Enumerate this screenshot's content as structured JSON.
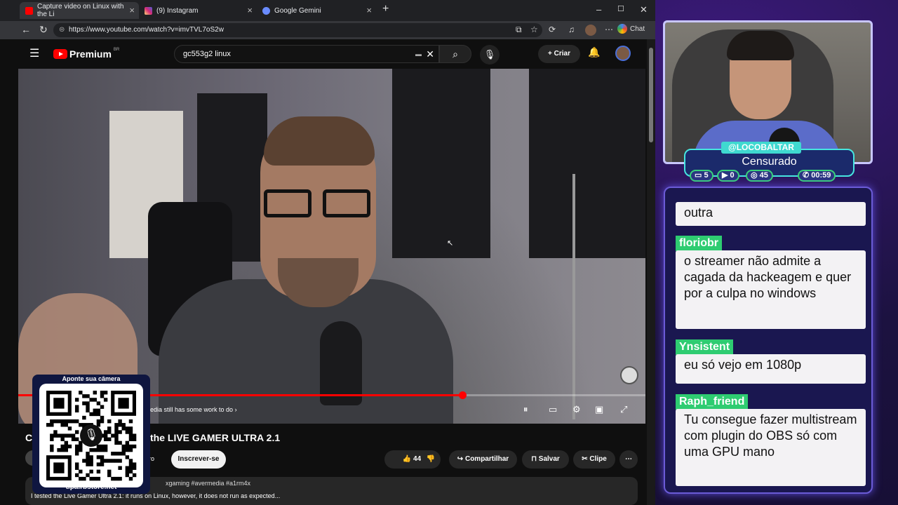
{
  "browser": {
    "tabs": [
      {
        "label": "Capture video on Linux with the Li",
        "active": true
      },
      {
        "label": "(9) Instagram",
        "active": false
      },
      {
        "label": "Google Gemini",
        "active": false
      }
    ],
    "url": "https://www.youtube.com/watch?v=imvTVL7oS2w",
    "chat_label": "Chat"
  },
  "youtube": {
    "logo_text": "Premium",
    "logo_region": "BR",
    "search_query": "gc553g2 linux",
    "create_label": "Criar",
    "chapter_text": "avermedia still has some work to do",
    "progress": 0.708,
    "video_title_partial": "C",
    "video_title": "the LIVE GAMER ULTRA 2.1",
    "membership_label": "bro",
    "subscribe_label": "Inscrever-se",
    "likes": "44",
    "share_label": "Compartilhar",
    "save_label": "Salvar",
    "clip_label": "Clipe",
    "tags": "xgaming #avermedia #a1rm4x",
    "description": "I tested the Live Gamer Ultra 2.1: it runs on Linux, however, it does not run as expected..."
  },
  "qr": {
    "top_text": "Aponte sua câmera",
    "bottom_text": "tipa.rbstore.net"
  },
  "stream": {
    "handle": "@LOCOBALTAR",
    "status": "Censurado",
    "stats": {
      "chat": "5",
      "youtube": "0",
      "viewers": "45",
      "time": "00:59"
    }
  },
  "chat": [
    {
      "user": "",
      "text": "outra"
    },
    {
      "user": "floriobr",
      "text": "o streamer não admite a cagada da hackeagem e quer por a culpa no windows"
    },
    {
      "user": "Ynsistent",
      "text": "eu só vejo em 1080p"
    },
    {
      "user": "Raph_friend",
      "text": "Tu consegue fazer multistream com plugin do OBS só com uma GPU mano"
    }
  ],
  "colors": {
    "accent": "#ff0000",
    "chat_user": "#2ecc71",
    "card_border": "#46e6e0"
  }
}
